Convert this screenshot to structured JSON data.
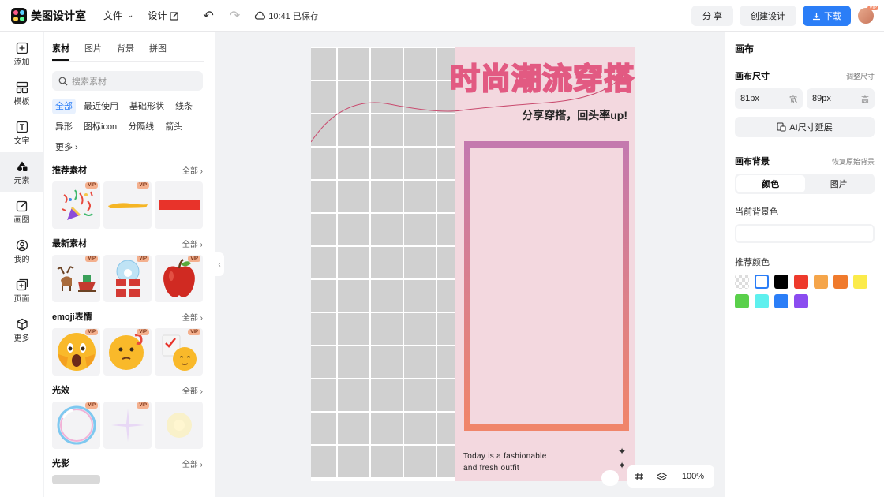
{
  "app": {
    "name": "美图设计室"
  },
  "topbar": {
    "file_menu": "文件",
    "design_menu": "设计",
    "saved_status": "10:41 已保存",
    "share_label": "分 享",
    "create_label": "创建设计",
    "download_label": "下载",
    "avatar_badge": "VIP"
  },
  "rail": {
    "items": [
      {
        "label": "添加",
        "icon": "plus-square-icon"
      },
      {
        "label": "模板",
        "icon": "template-icon"
      },
      {
        "label": "文字",
        "icon": "text-icon"
      },
      {
        "label": "元素",
        "icon": "shapes-icon"
      },
      {
        "label": "画图",
        "icon": "draw-icon"
      },
      {
        "label": "我的",
        "icon": "user-icon"
      },
      {
        "label": "页面",
        "icon": "page-add-icon"
      },
      {
        "label": "更多",
        "icon": "cube-icon"
      }
    ],
    "active": 3
  },
  "panel": {
    "tabs": [
      "素材",
      "图片",
      "背景",
      "拼图"
    ],
    "search_placeholder": "搜索素材",
    "chips": [
      "全部",
      "最近使用",
      "基础形状",
      "线条",
      "异形",
      "图标icon",
      "分隔线",
      "箭头",
      "更多"
    ],
    "vip_badge": "VIP",
    "all_label": "全部",
    "sections": [
      {
        "title": "推荐素材",
        "items": [
          "party-popper",
          "yellow-brush",
          "red-bar"
        ]
      },
      {
        "title": "最新素材",
        "items": [
          "reindeer-sleigh",
          "snow-globe-gift",
          "red-apple"
        ]
      },
      {
        "title": "emoji表情",
        "items": [
          "shocked-face",
          "thinking-face",
          "checklist-face"
        ]
      },
      {
        "title": "光效",
        "items": [
          "rainbow-bubble",
          "star-sparkle",
          "soft-glow"
        ]
      },
      {
        "title": "光影",
        "items": []
      }
    ]
  },
  "canvas": {
    "headline": "时尚潮流穿搭",
    "subline": "分享穿搭，回头率up!",
    "tagline_1": "Today is a fashionable",
    "tagline_2": "and fresh outfit",
    "sparkle": "✦"
  },
  "zoom": {
    "level": "100%"
  },
  "right": {
    "title": "画布",
    "size_label": "画布尺寸",
    "size_link": "调整尺寸",
    "width_value": "81px",
    "width_unit": "宽",
    "height_value": "89px",
    "height_unit": "高",
    "ai_button": "AI尺寸延展",
    "bg_label": "画布背景",
    "bg_link": "恢复原始背景",
    "seg_color": "颜色",
    "seg_image": "图片",
    "current_bg_label": "当前背景色",
    "recommend_label": "推荐颜色",
    "swatches": [
      "transparent",
      "#ffffff",
      "#000000",
      "#ee3a2c",
      "#f5a54a",
      "#f07a2c",
      "#fbeb4a",
      "#5ad04b",
      "#5ef0ee",
      "#2b7ef7",
      "#8b4cf0"
    ]
  }
}
